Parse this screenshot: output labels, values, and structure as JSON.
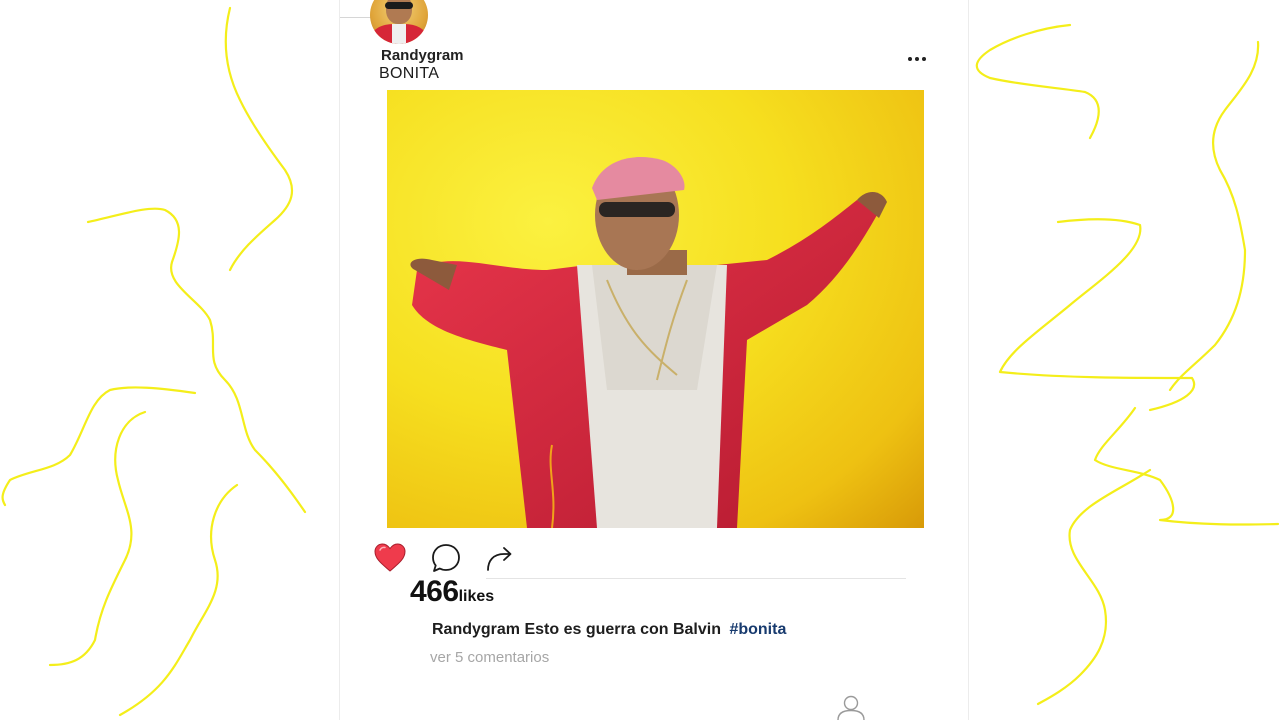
{
  "post": {
    "username": "Randygram",
    "location": "BONITA",
    "more_icon": "more-dots-icon",
    "likes": {
      "count": "466",
      "label": "likes"
    },
    "caption": {
      "username": "Randygram",
      "text": "Esto es guerra con Balvin",
      "hashtag": "#bonita"
    },
    "comments_link": "ver 5 comentarios",
    "liked": true
  },
  "icons": {
    "like": "heart-icon",
    "comment": "comment-bubble-icon",
    "share": "share-arrow-icon",
    "profile": "person-icon"
  },
  "colors": {
    "like_red": "#ef3b4c",
    "hashtag_blue": "#173a6e",
    "photo_yellow": "#f6df1f",
    "doodle_yellow": "#f4ee1a",
    "muted_text": "#a6a6a6"
  }
}
